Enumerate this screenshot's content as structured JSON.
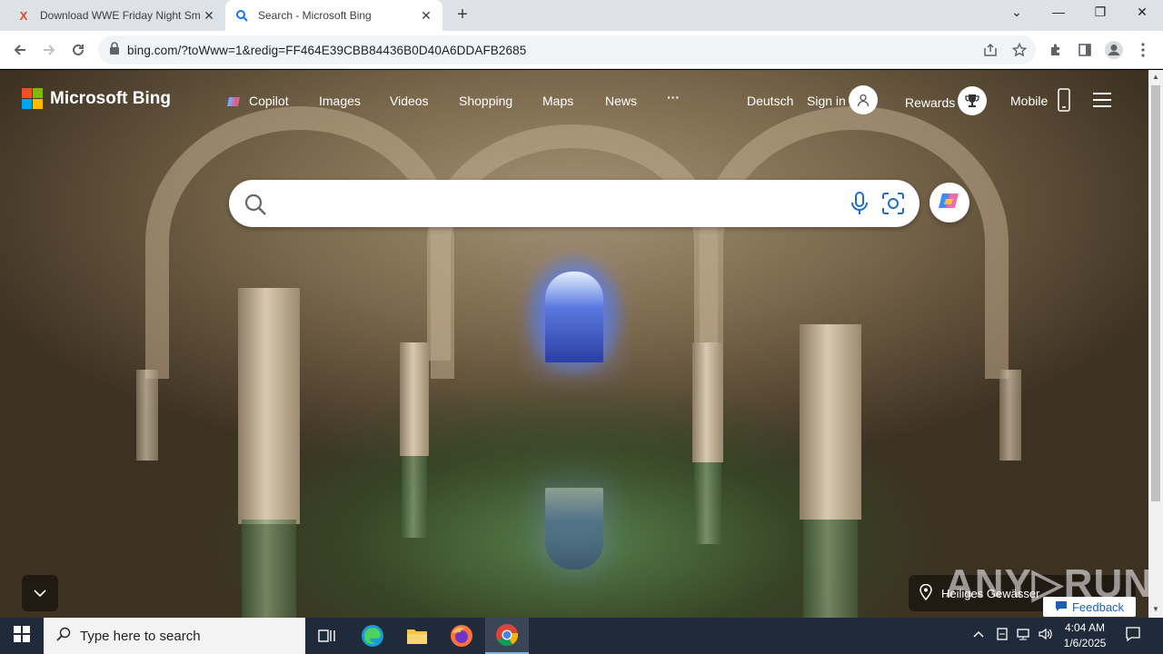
{
  "browser": {
    "tabs": [
      {
        "title": "Download WWE Friday Night Sm",
        "icon": "x-favicon",
        "active": false
      },
      {
        "title": "Search - Microsoft Bing",
        "icon": "bing-search-favicon",
        "active": true
      }
    ],
    "address": "bing.com/?toWww=1&redig=FF464E39CBB84436B0D40A6DDAFB2685"
  },
  "bing": {
    "logo_text": "Microsoft Bing",
    "nav": {
      "copilot": "Copilot",
      "images": "Images",
      "videos": "Videos",
      "shopping": "Shopping",
      "maps": "Maps",
      "news": "News",
      "more": "···",
      "language": "Deutsch",
      "sign_in": "Sign in",
      "rewards": "Rewards",
      "mobile": "Mobile"
    },
    "search": {
      "placeholder": "",
      "value": ""
    },
    "image_caption": "Heiliges Gewässer",
    "feedback": "Feedback"
  },
  "watermark": "ANY▷RUN",
  "taskbar": {
    "search_placeholder": "Type here to search",
    "time": "4:04 AM",
    "date": "1/6/2025"
  }
}
